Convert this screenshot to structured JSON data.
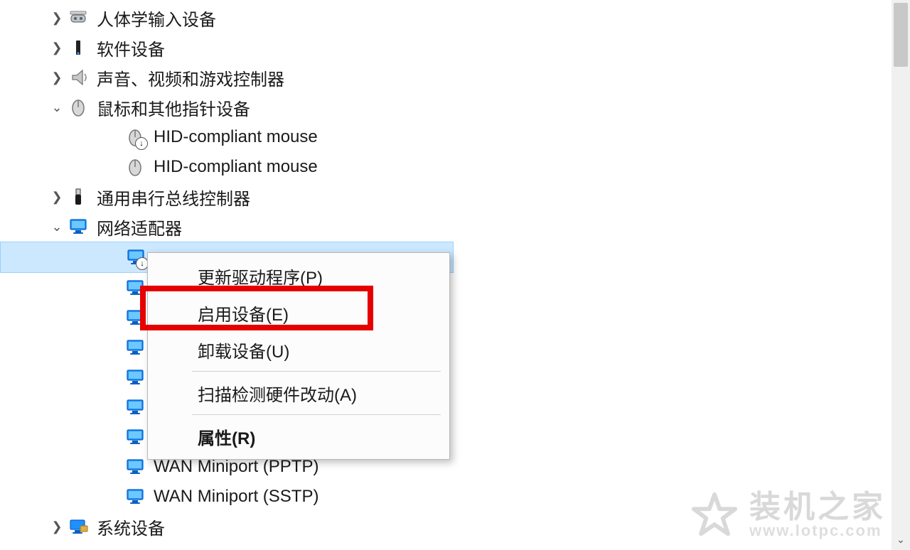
{
  "tree": {
    "hid": {
      "label": "人体学输入设备"
    },
    "software": {
      "label": "软件设备"
    },
    "audio": {
      "label": "声音、视频和游戏控制器"
    },
    "mouse": {
      "label": "鼠标和其他指针设备"
    },
    "mouse_children": [
      {
        "label": "HID-compliant mouse"
      },
      {
        "label": "HID-compliant mouse"
      }
    ],
    "usb": {
      "label": "通用串行总线控制器"
    },
    "network": {
      "label": "网络适配器"
    },
    "network_children": [
      {
        "label": "WAN Miniport (PPTP)"
      },
      {
        "label": "WAN Miniport (SSTP)"
      }
    ],
    "system": {
      "label": "系统设备"
    }
  },
  "context_menu": {
    "update": "更新驱动程序(P)",
    "enable": "启用设备(E)",
    "uninstall": "卸载设备(U)",
    "scan": "扫描检测硬件改动(A)",
    "properties": "属性(R)"
  },
  "watermark": {
    "title": "装机之家",
    "url": "www.lotpc.com"
  }
}
